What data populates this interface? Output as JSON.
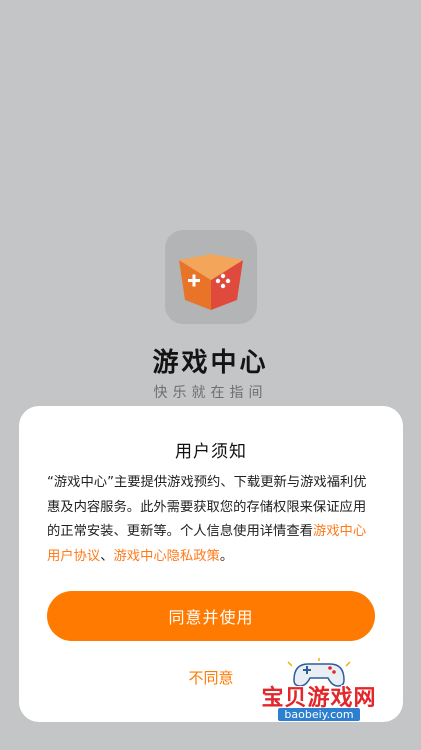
{
  "app": {
    "name": "游戏中心",
    "slogan": "快乐就在指间",
    "icon": "game-controller-icon"
  },
  "dialog": {
    "title": "用户须知",
    "body_text": "“游戏中心”主要提供游戏预约、下载更新与游戏福利优惠及内容服务。此外需要获取您的存储权限来保证应用的正常安装、更新等。个人信息使用详情查看",
    "link_user_agreement": "游戏中心用户协议",
    "separator": "、",
    "link_privacy_policy": "游戏中心隐私政策",
    "ending": "。",
    "agree_label": "同意并使用",
    "disagree_label": "不同意"
  },
  "watermark": {
    "title": "宝贝游戏网",
    "url": "baobeiy.com"
  },
  "colors": {
    "accent": "#ff7a00",
    "background": "#c4c5c7",
    "dialog": "#ffffff"
  }
}
